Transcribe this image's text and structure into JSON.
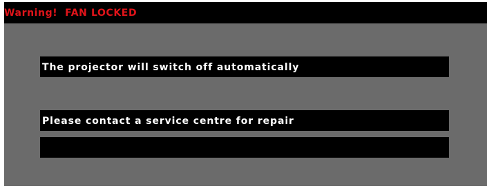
{
  "osd": {
    "title": "Warning!  FAN LOCKED",
    "messages": [
      "The projector will switch off automatically",
      "Please contact a service centre for repair",
      ""
    ]
  },
  "colors": {
    "panel_background": "#6b6b6b",
    "title_bar": "#000000",
    "title_text": "#e0141a",
    "message_box": "#000000",
    "message_text": "#ffffff"
  }
}
